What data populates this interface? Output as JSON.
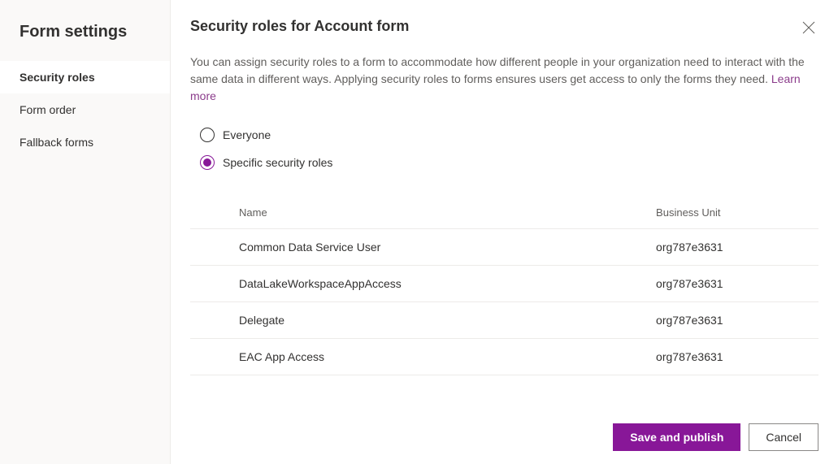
{
  "sidebar": {
    "title": "Form settings",
    "items": [
      {
        "label": "Security roles",
        "active": true
      },
      {
        "label": "Form order",
        "active": false
      },
      {
        "label": "Fallback forms",
        "active": false
      }
    ]
  },
  "main": {
    "title": "Security roles for Account form",
    "description": "You can assign security roles to a form to accommodate how different people in your organization need to interact with the same data in different ways. Applying security roles to forms ensures users get access to only the forms they need. ",
    "learn_more": "Learn more"
  },
  "radio": {
    "everyone": "Everyone",
    "specific": "Specific security roles",
    "selected": "specific"
  },
  "table": {
    "headers": {
      "name": "Name",
      "business_unit": "Business Unit"
    },
    "rows": [
      {
        "name": "Common Data Service User",
        "business_unit": "org787e3631"
      },
      {
        "name": "DataLakeWorkspaceAppAccess",
        "business_unit": "org787e3631"
      },
      {
        "name": "Delegate",
        "business_unit": "org787e3631"
      },
      {
        "name": "EAC App Access",
        "business_unit": "org787e3631"
      }
    ]
  },
  "footer": {
    "save": "Save and publish",
    "cancel": "Cancel"
  }
}
